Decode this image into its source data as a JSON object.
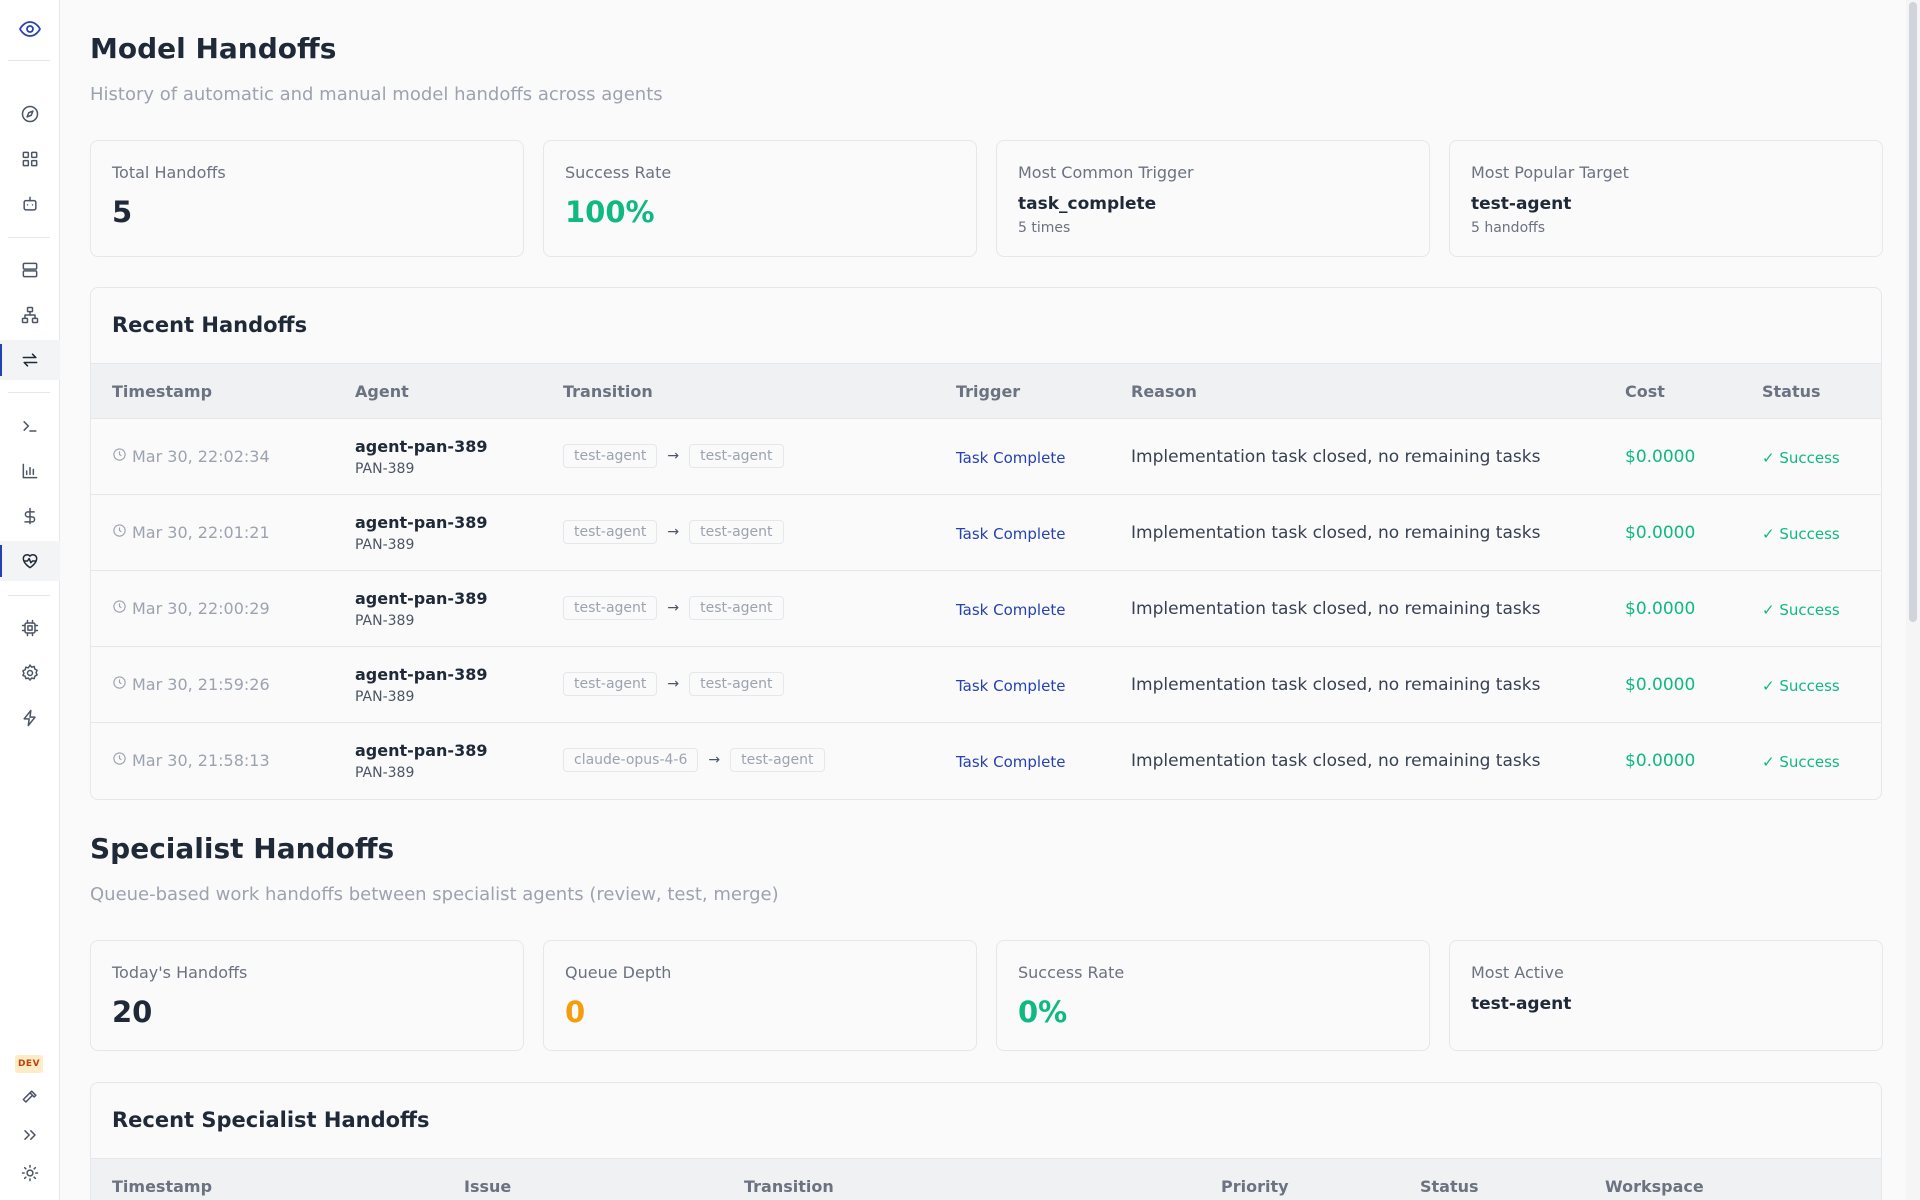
{
  "sidebar": {
    "icons": [
      "eye-icon",
      "compass-icon",
      "grid-icon",
      "bot-icon",
      "server-icon",
      "network-icon",
      "arrows-swap-icon",
      "terminal-icon",
      "bar-chart-icon",
      "dollar-icon",
      "heart-pulse-icon",
      "chip-icon",
      "gear-icon",
      "bolt-icon",
      "hammer-icon",
      "chevrons-right-icon",
      "sun-icon"
    ],
    "dev_badge": "DEV"
  },
  "model_handoffs": {
    "title": "Model Handoffs",
    "subtitle": "History of automatic and manual model handoffs across agents",
    "stats": {
      "total": {
        "label": "Total Handoffs",
        "value": "5"
      },
      "success_rate": {
        "label": "Success Rate",
        "value": "100%"
      },
      "common_trigger": {
        "label": "Most Common Trigger",
        "value": "task_complete",
        "sub": "5 times"
      },
      "popular_target": {
        "label": "Most Popular Target",
        "value": "test-agent",
        "sub": "5 handoffs"
      }
    },
    "recent": {
      "title": "Recent Handoffs",
      "columns": {
        "timestamp": "Timestamp",
        "agent": "Agent",
        "transition": "Transition",
        "trigger": "Trigger",
        "reason": "Reason",
        "cost": "Cost",
        "status": "Status"
      },
      "rows": [
        {
          "timestamp": "Mar 30, 22:02:34",
          "agent": "agent-pan-389",
          "agent_id": "PAN-389",
          "from": "test-agent",
          "to": "test-agent",
          "trigger": "Task Complete",
          "reason": "Implementation task closed, no remaining tasks",
          "cost": "$0.0000",
          "status": "Success"
        },
        {
          "timestamp": "Mar 30, 22:01:21",
          "agent": "agent-pan-389",
          "agent_id": "PAN-389",
          "from": "test-agent",
          "to": "test-agent",
          "trigger": "Task Complete",
          "reason": "Implementation task closed, no remaining tasks",
          "cost": "$0.0000",
          "status": "Success"
        },
        {
          "timestamp": "Mar 30, 22:00:29",
          "agent": "agent-pan-389",
          "agent_id": "PAN-389",
          "from": "test-agent",
          "to": "test-agent",
          "trigger": "Task Complete",
          "reason": "Implementation task closed, no remaining tasks",
          "cost": "$0.0000",
          "status": "Success"
        },
        {
          "timestamp": "Mar 30, 21:59:26",
          "agent": "agent-pan-389",
          "agent_id": "PAN-389",
          "from": "test-agent",
          "to": "test-agent",
          "trigger": "Task Complete",
          "reason": "Implementation task closed, no remaining tasks",
          "cost": "$0.0000",
          "status": "Success"
        },
        {
          "timestamp": "Mar 30, 21:58:13",
          "agent": "agent-pan-389",
          "agent_id": "PAN-389",
          "from": "claude-opus-4-6",
          "to": "test-agent",
          "trigger": "Task Complete",
          "reason": "Implementation task closed, no remaining tasks",
          "cost": "$0.0000",
          "status": "Success"
        }
      ]
    }
  },
  "specialist_handoffs": {
    "title": "Specialist Handoffs",
    "subtitle": "Queue-based work handoffs between specialist agents (review, test, merge)",
    "stats": {
      "today": {
        "label": "Today's Handoffs",
        "value": "20"
      },
      "queue_depth": {
        "label": "Queue Depth",
        "value": "0"
      },
      "success_rate": {
        "label": "Success Rate",
        "value": "0%"
      },
      "most_active": {
        "label": "Most Active",
        "value": "test-agent"
      }
    },
    "recent": {
      "title": "Recent Specialist Handoffs",
      "columns": {
        "timestamp": "Timestamp",
        "issue": "Issue",
        "transition": "Transition",
        "priority": "Priority",
        "status": "Status",
        "workspace": "Workspace"
      }
    }
  }
}
